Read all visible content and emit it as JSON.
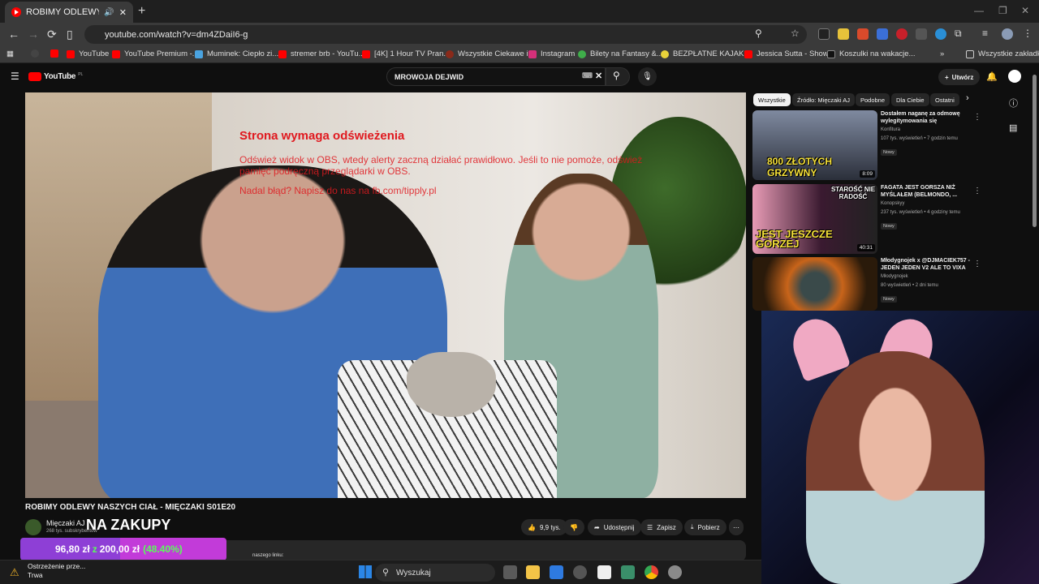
{
  "browser": {
    "tab_title": "ROBIMY ODLEWY NASZYCH",
    "new_tab": "+",
    "url": "youtube.com/watch?v=dm4ZDaiI6-g",
    "all_bookmarks": "Wszystkie zakładki",
    "bookmarks": [
      "YouTube",
      "YouTube Premium -...",
      "Muminek: Ciepło zi...",
      "stremer brb - YouTu...",
      "[4K] 1 Hour TV Pran...",
      "Wszystkie Ciekawe i...",
      "Instagram",
      "Bilety na Fantasy &...",
      "BEZPŁATNE KAJAKI...",
      "Jessica Sutta - Show...",
      "Koszulki na wakacje..."
    ]
  },
  "youtube": {
    "logo": "YouTube",
    "logo_region": "PL",
    "search_value": "MROWOJA DEJWID",
    "create_label": "Utwórz",
    "video_title": "ROBIMY ODLEWY NASZYCH CIAŁ - MIĘCZAKI S01E20",
    "channel_name": "Mięczaki AJ",
    "channel_subs": "268 tys. subskrybentów",
    "likes": "9,9 tys.",
    "share": "Udostępnij",
    "save": "Zapisz",
    "download": "Pobierz",
    "description_snippet": "naszego linku:",
    "overlay": {
      "title": "Strona wymaga odświeżenia",
      "line1": "Odśwież widok w OBS, wtedy alerty zaczną działać prawidłowo. Jeśli to nie pomoże, odśwież pamięć podręczną przeglądarki w OBS.",
      "line2": "Nadal błąd? Napisz do nas na fb.com/tipply.pl"
    },
    "chips": [
      "Wszystkie",
      "Źródło: Mięczaki AJ",
      "Podobne",
      "Dla Ciebie",
      "Ostatni"
    ],
    "recommendations": [
      {
        "title": "Dostałem naganę za odmowę wylegitymowania się",
        "channel": "Konfitura",
        "meta": "107 tys. wyświetleń • 7 godzin temu",
        "badge": "Nowy",
        "duration": "8:09",
        "thumb_text": "800 ZŁOTYCH GRZYWNY"
      },
      {
        "title": "FAGATA JEST GORSZA NIŻ MYŚLAŁEM (BELMONDO, ...",
        "channel": "Konopskyy",
        "meta": "237 tys. wyświetleń • 4 godziny temu",
        "badge": "Nowy",
        "duration": "40:31",
        "thumb_text": "JEST JESZCZE GORZEJ"
      },
      {
        "title": "Młodygnojek x @DJMACIEK757 - JEDEN JEDEN V2 ALE TO VIXA",
        "channel": "Młodygnojek",
        "meta": "80 wyświetleń • 2 dni temu",
        "badge": "Nowy",
        "duration": "",
        "thumb_text": ""
      }
    ],
    "thumb1_sub": "STAROŚĆ NIE RADOŚĆ"
  },
  "stream_overlay": {
    "na_zakupy": "NA ZAKUPY",
    "donation_current": "96,80 zł",
    "donation_sep": "z",
    "donation_goal": "200,00 zł",
    "donation_pct": "(48.40%)",
    "donation_progress": 0.484
  },
  "taskbar": {
    "warning_title": "Ostrzeżenie prze...",
    "warning_sub": "Trwa",
    "search_placeholder": "Wyszukaj"
  },
  "colors": {
    "youtube_red": "#ff0000",
    "overlay_red": "#e0191f",
    "donation_purple": "#8e3fd6",
    "donation_green": "#59ff59"
  }
}
